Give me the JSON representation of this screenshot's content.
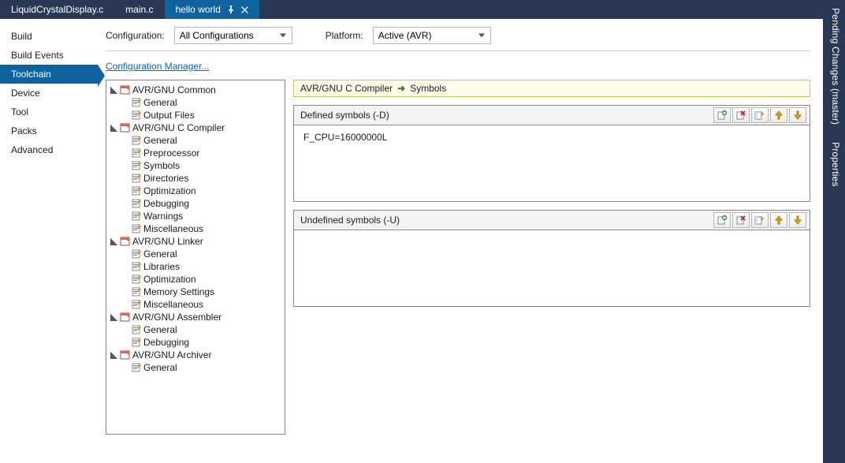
{
  "tabs": {
    "items": [
      {
        "label": "LiquidCrystalDisplay.c",
        "active": false
      },
      {
        "label": "main.c",
        "active": false
      },
      {
        "label": "hello world",
        "active": true
      }
    ]
  },
  "rightPanels": {
    "items": [
      {
        "label": "Pending Changes (master)"
      },
      {
        "label": "Properties"
      }
    ]
  },
  "sideNav": {
    "items": [
      {
        "label": "Build",
        "selected": false
      },
      {
        "label": "Build Events",
        "selected": false
      },
      {
        "label": "Toolchain",
        "selected": true
      },
      {
        "label": "Device",
        "selected": false
      },
      {
        "label": "Tool",
        "selected": false
      },
      {
        "label": "Packs",
        "selected": false
      },
      {
        "label": "Advanced",
        "selected": false
      }
    ]
  },
  "config": {
    "configurationLabel": "Configuration:",
    "configurationValue": "All Configurations",
    "platformLabel": "Platform:",
    "platformValue": "Active (AVR)",
    "managerLink": "Configuration Manager..."
  },
  "tree": [
    {
      "label": "AVR/GNU Common",
      "children": [
        {
          "label": "General"
        },
        {
          "label": "Output Files"
        }
      ]
    },
    {
      "label": "AVR/GNU C Compiler",
      "children": [
        {
          "label": "General"
        },
        {
          "label": "Preprocessor"
        },
        {
          "label": "Symbols"
        },
        {
          "label": "Directories"
        },
        {
          "label": "Optimization"
        },
        {
          "label": "Debugging"
        },
        {
          "label": "Warnings"
        },
        {
          "label": "Miscellaneous"
        }
      ]
    },
    {
      "label": "AVR/GNU Linker",
      "children": [
        {
          "label": "General"
        },
        {
          "label": "Libraries"
        },
        {
          "label": "Optimization"
        },
        {
          "label": "Memory Settings"
        },
        {
          "label": "Miscellaneous"
        }
      ]
    },
    {
      "label": "AVR/GNU Assembler",
      "children": [
        {
          "label": "General"
        },
        {
          "label": "Debugging"
        }
      ]
    },
    {
      "label": "AVR/GNU Archiver",
      "children": [
        {
          "label": "General"
        }
      ]
    }
  ],
  "breadcrumb": {
    "group": "AVR/GNU C Compiler",
    "leaf": "Symbols"
  },
  "defined": {
    "title": "Defined symbols (-D)",
    "items": [
      "F_CPU=16000000L"
    ]
  },
  "undefined": {
    "title": "Undefined symbols (-U)",
    "items": []
  },
  "iconButtons": {
    "add": "add-item-icon",
    "remove": "remove-item-icon",
    "edit": "edit-item-icon",
    "up": "move-up-icon",
    "down": "move-down-icon"
  }
}
